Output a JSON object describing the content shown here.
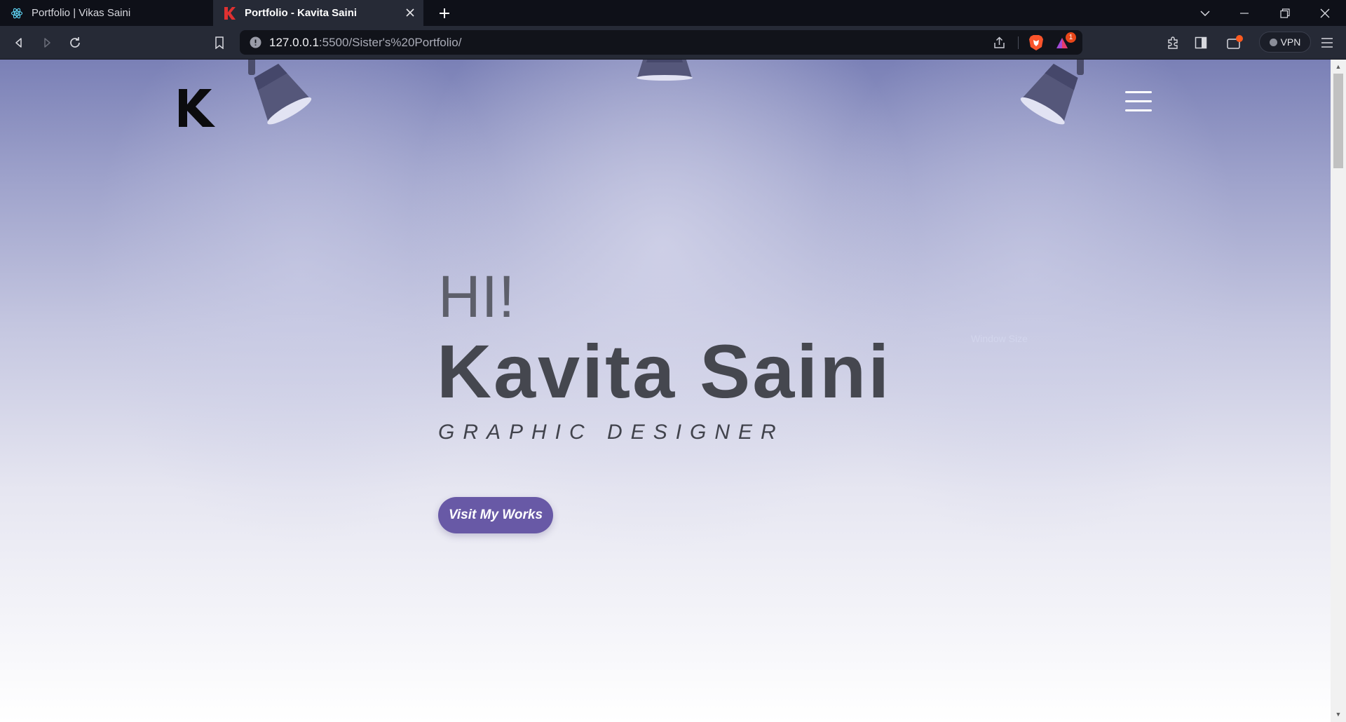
{
  "browser": {
    "tabs": [
      {
        "title": "Portfolio | Vikas Saini",
        "favicon": "react-icon",
        "active": false
      },
      {
        "title": "Portfolio - Kavita Saini",
        "favicon": "k-logo-icon",
        "active": true
      }
    ],
    "url": {
      "host": "127.0.0.1",
      "path": ":5500/Sister's%20Portfolio/"
    },
    "vpn_label": "VPN",
    "shields_badge": "1"
  },
  "page": {
    "greeting": "HI!",
    "name": "Kavita Saini",
    "role": "GRAPHIC DESIGNER",
    "cta_label": "Visit My Works",
    "logo_letter": "K",
    "faint_overlay_text": "Window Size"
  },
  "colors": {
    "accent": "#6859a6",
    "heading": "#45474f",
    "lamp": "#4d4e6e"
  }
}
